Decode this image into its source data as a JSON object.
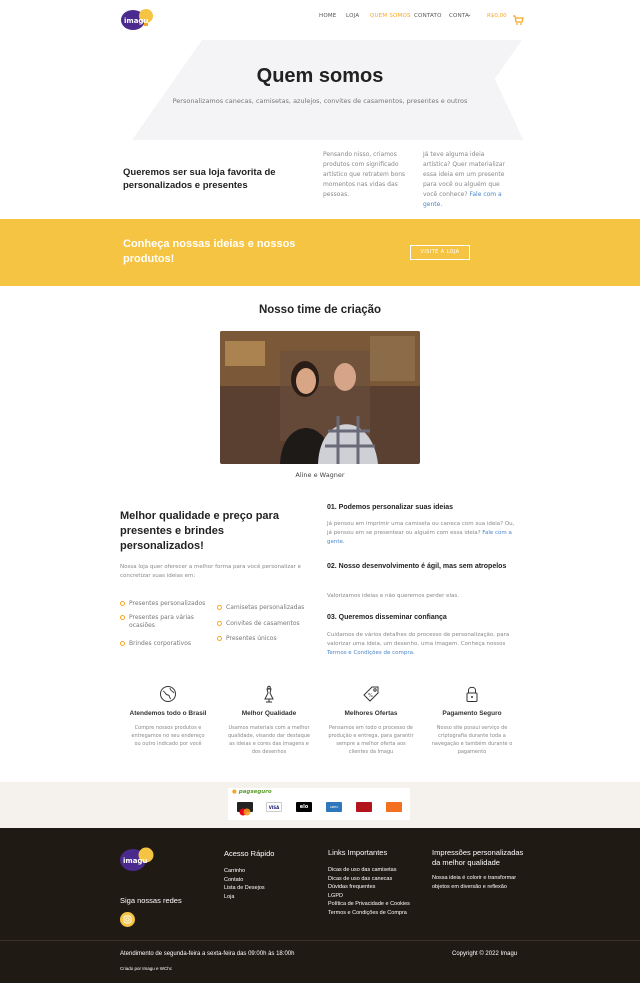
{
  "header": {
    "logo_text": "imagu",
    "nav": [
      "HOME",
      "LOJA",
      "QUEM SOMOS",
      "CONTATO",
      "CONTA"
    ],
    "active_nav": "QUEM SOMOS",
    "cart_price": "R$0,00",
    "accent_color": "#f6a623"
  },
  "hero": {
    "title": "Quem somos",
    "subtitle": "Personalizamos canecas, camisetas, azulejos, convites de casamentos, presentes e outros"
  },
  "intro": {
    "heading": "Queremos ser sua loja favorita de personalizados e presentes",
    "col1": "Pensando nisso, criamos produtos com significado artístico que retratem bons momentos nas vidas das pessoas.",
    "col2_text": "Já teve alguma ideia artística? Quer materializar essa ideia em um presente para você ou alguém que você conhece?",
    "col2_link": "Fale com a gente."
  },
  "banner": {
    "text": "Conheça nossas ideias e nossos produtos!",
    "button": "VISITE A LOJA",
    "color": "#f6c443"
  },
  "team": {
    "title": "Nosso time de criação",
    "caption": "Aline e Wagner"
  },
  "quality": {
    "heading": "Melhor qualidade e preço para presentes e brindes personalizados!",
    "text": "Nossa loja quer oferecer a melhor forma para você personalizar e concretizar suas ideias em:",
    "bullets_left": [
      "Presentes personalizados",
      "Presentes para várias ocasiões",
      "Brindes corporativos"
    ],
    "bullets_right": [
      "Camisetas personalizadas",
      "Convites de casamentos",
      "Presentes únicos"
    ]
  },
  "faq": [
    {
      "title": "01. Podemos personalizar suas ideias",
      "text": "Já pensou em imprimir uma camiseta ou caneca com sua ideia? Ou, já pensou em se presentear ou alguém com essa ideia?",
      "link": "Fale com a gente."
    },
    {
      "title": "02. Nosso desenvolvimento é ágil, mas sem atropelos",
      "text": "Valorizamos ideias e não queremos perder elas.",
      "link": ""
    },
    {
      "title": "03. Queremos disseminar confiança",
      "text": "Cuidamos de vários detalhes do processo de personalização, para valorizar uma ideia, um desenho, uma imagem. Conheça nossos",
      "link": "Termos e Condições de compra."
    }
  ],
  "features": [
    {
      "icon": "globe-icon",
      "title": "Atendemos todo o Brasil",
      "text": "Compre nossos produtos e entregamos no seu endereço ou outro indicado por você"
    },
    {
      "icon": "dress-form-icon",
      "title": "Melhor Qualidade",
      "text": "Usamos materiais com a melhor qualidade, visando dar destaque as ideias e cores das imagens e dos desenhos"
    },
    {
      "icon": "price-tag-icon",
      "title": "Melhores Ofertas",
      "text": "Pensamos em todo o processo de produção e entrega, para garantir sempre a melhor oferta aos clientes da Imagu"
    },
    {
      "icon": "lock-icon",
      "title": "Pagamento Seguro",
      "text": "Nosso site possui serviço de criptografia durante toda a navegação e também durante o pagamento"
    }
  ],
  "payment": {
    "provider": "pagseguro",
    "cards": [
      "mastercard",
      "VISA",
      "elo",
      "AMEX",
      "hipercard",
      "hiper"
    ]
  },
  "footer": {
    "follow": "Siga nossas redes",
    "quick_title": "Acesso Rápido",
    "quick_links": [
      "Carrinho",
      "Contato",
      "Lista de Desejos",
      "Loja"
    ],
    "important_title": "Links Importantes",
    "important_links": [
      "Dicas de uso das camisetas",
      "Dicas de uso das canecas",
      "Dúvidas frequentes",
      "LGPD",
      "Política de Privacidade e Cookies",
      "Termos e Condições de Compra"
    ],
    "about_title": "Impressões personalizadas da melhor qualidade",
    "about_text": "Nossa ideia é colorir e transformar objetos em diversão e reflexão",
    "hours": "Atendimento de segunda-feira a sexta-feira das 09:00h às 18:00h",
    "copyright": "Copyright © 2022 Imagu",
    "credit": "Criado por Imagu e WChc"
  }
}
